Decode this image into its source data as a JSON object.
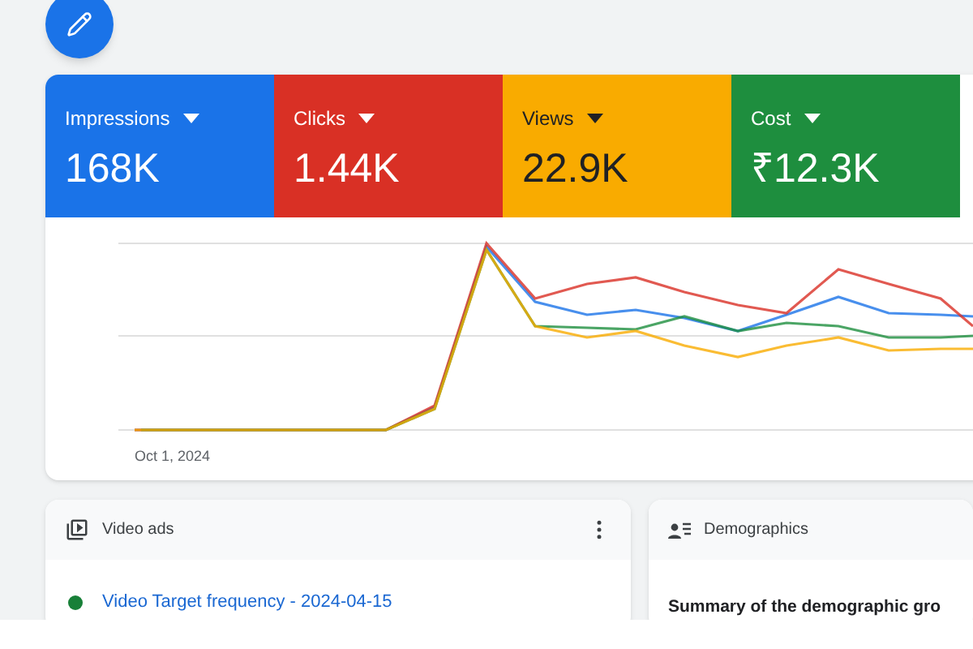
{
  "metrics": [
    {
      "label": "Impressions",
      "value": "168K",
      "color": "#1a73e8",
      "selected": true
    },
    {
      "label": "Clicks",
      "value": "1.44K",
      "color": "#d93025",
      "selected": true
    },
    {
      "label": "Views",
      "value": "22.9K",
      "color": "#f9ab00",
      "selected": true
    },
    {
      "label": "Cost",
      "value": "₹12.3K",
      "color": "#1e8e3e",
      "selected": true
    }
  ],
  "chart": {
    "x_label": "Oct 1, 2024"
  },
  "cards": [
    {
      "kind": "list",
      "title": "Video ads",
      "items": [
        {
          "title": "Video Target frequency - 2024-04-15",
          "color": "#188038"
        }
      ]
    },
    {
      "kind": "summary",
      "title": "Demographics",
      "summary": "Summary of the demographic gro"
    }
  ]
}
